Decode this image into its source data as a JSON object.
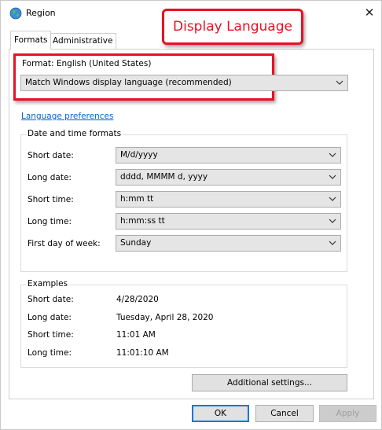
{
  "window": {
    "title": "Region",
    "close_glyph": "✕"
  },
  "tabs": [
    {
      "label": "Formats",
      "active": true
    },
    {
      "label": "Administrative",
      "active": false
    }
  ],
  "callout": {
    "text": "Display Language",
    "color": "#e81123"
  },
  "format": {
    "label": "Format: English (United States)",
    "value": "Match Windows display language (recommended)"
  },
  "language_link": "Language preferences",
  "date_time": {
    "title": "Date and time formats",
    "rows": [
      {
        "label": "Short date:",
        "value": "M/d/yyyy"
      },
      {
        "label": "Long date:",
        "value": "dddd, MMMM d, yyyy"
      },
      {
        "label": "Short time:",
        "value": "h:mm tt"
      },
      {
        "label": "Long time:",
        "value": "h:mm:ss tt"
      },
      {
        "label": "First day of week:",
        "value": "Sunday"
      }
    ]
  },
  "examples": {
    "title": "Examples",
    "rows": [
      {
        "label": "Short date:",
        "value": "4/28/2020"
      },
      {
        "label": "Long date:",
        "value": "Tuesday, April 28, 2020"
      },
      {
        "label": "Short time:",
        "value": "11:01 AM"
      },
      {
        "label": "Long time:",
        "value": "11:01:10 AM"
      }
    ]
  },
  "buttons": {
    "additional": "Additional settings...",
    "ok": "OK",
    "cancel": "Cancel",
    "apply": "Apply"
  },
  "icons": {
    "title": "globe-icon",
    "close": "close-icon",
    "dropdown": "chevron-down-icon"
  }
}
